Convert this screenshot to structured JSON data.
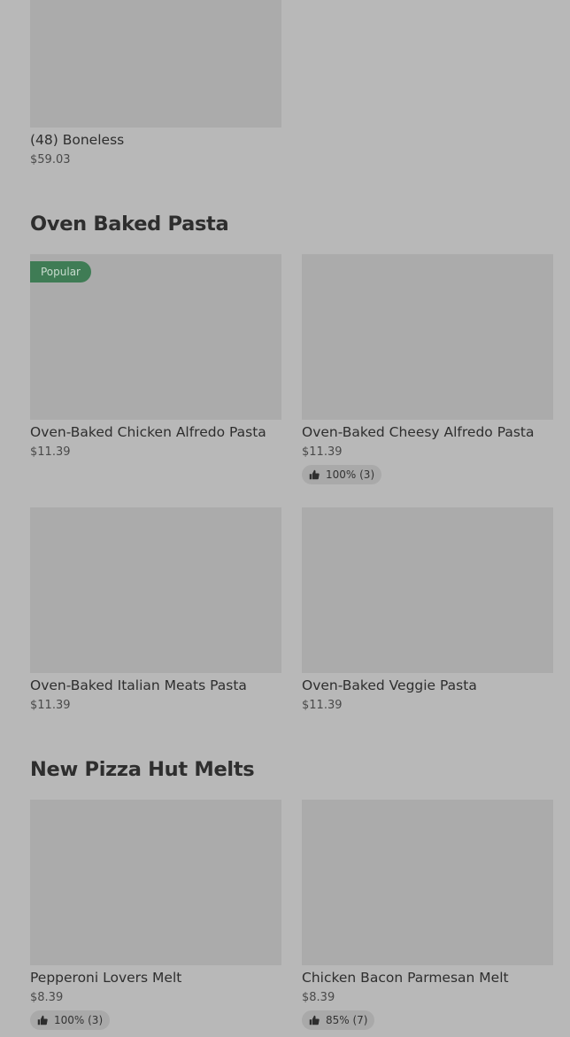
{
  "colors": {
    "background": "#b8b8b8",
    "image_placeholder": "#ababab",
    "popular_badge": "#3f7c55",
    "rating_pill": "#a9a9a9"
  },
  "top_item": {
    "name": "(48) Boneless",
    "price": "$59.03"
  },
  "sections": [
    {
      "title": "Oven Baked Pasta",
      "items": [
        {
          "name": "Oven-Baked Chicken Alfredo Pasta",
          "price": "$11.39",
          "badge": "Popular"
        },
        {
          "name": "Oven-Baked Cheesy Alfredo Pasta",
          "price": "$11.39",
          "rating": "100% (3)",
          "rating_icon": "thumbs-up-icon"
        },
        {
          "name": "Oven-Baked Italian Meats Pasta",
          "price": "$11.39"
        },
        {
          "name": "Oven-Baked Veggie Pasta",
          "price": "$11.39"
        }
      ]
    },
    {
      "title": "New Pizza Hut Melts",
      "items": [
        {
          "name": "Pepperoni Lovers Melt",
          "price": "$8.39",
          "rating": "100% (3)",
          "rating_icon": "thumbs-up-icon"
        },
        {
          "name": "Chicken Bacon Parmesan Melt",
          "price": "$8.39",
          "rating": "85% (7)",
          "rating_icon": "thumbs-up-icon"
        }
      ]
    }
  ]
}
